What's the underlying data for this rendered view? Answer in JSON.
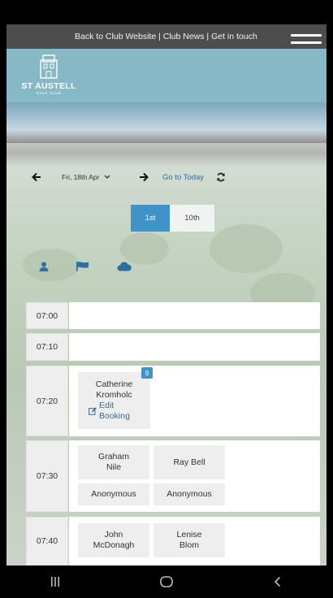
{
  "top_bar": {
    "links": "Back to Club Website | Club News | Get in touch"
  },
  "logo": {
    "name": "ST AUSTELL",
    "sub": "GOLF CLUB"
  },
  "date_nav": {
    "date": "Fri, 18th Apr",
    "goto_today": "Go to Today"
  },
  "tee_toggle": {
    "first": "1st",
    "tenth": "10th"
  },
  "slots": [
    {
      "time": "07:00",
      "players": []
    },
    {
      "time": "07:10",
      "players": []
    },
    {
      "time": "07:20",
      "players": [
        {
          "name": "Catherine Kromholc",
          "badge": "9",
          "edit": "Edit Booking"
        }
      ]
    },
    {
      "time": "07:30",
      "players": [
        {
          "name": "Graham Nile"
        },
        {
          "name": "Ray Bell"
        },
        {
          "name": "Anonymous"
        },
        {
          "name": "Anonymous"
        }
      ]
    },
    {
      "time": "07:40",
      "players": [
        {
          "name": "John McDonagh"
        },
        {
          "name": "Lenise Blom"
        }
      ]
    }
  ],
  "colors": {
    "accent": "#3f93c8",
    "link": "#2f6fa0",
    "top_bar": "#4d4d4d",
    "header_band": "#86b9c5"
  }
}
